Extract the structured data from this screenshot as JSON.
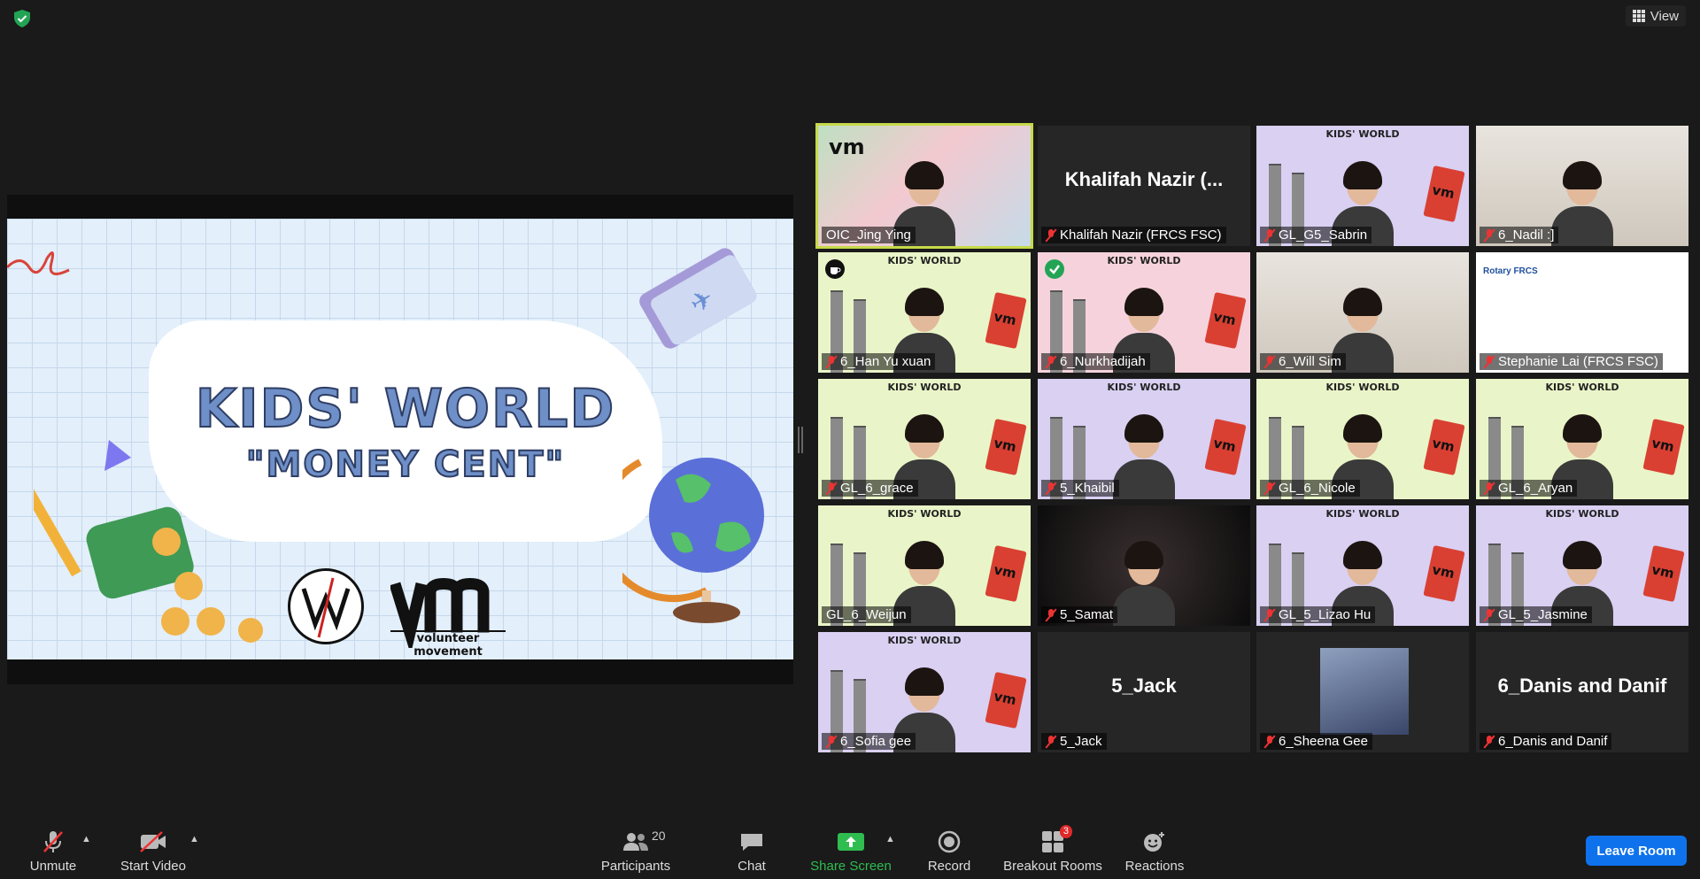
{
  "top": {
    "view_label": "View",
    "shield_icon": "shield-check-icon"
  },
  "slide": {
    "title": "KIDS' WORLD",
    "subtitle": "\"MONEY CENT\"",
    "vm_tagline": "volunteer movement"
  },
  "tiles": [
    {
      "name": "OIC_Jing Ying",
      "muted": false,
      "active": true,
      "style": "vm-pink"
    },
    {
      "name": "Khalifah Nazir (FRCS FSC)",
      "big": "Khalifah Nazir (...",
      "muted": true,
      "style": "dark"
    },
    {
      "name": "GL_G5_Sabrin",
      "muted": true,
      "style": "kw-purple"
    },
    {
      "name": "6_Nadil :]",
      "muted": true,
      "style": "room"
    },
    {
      "name": "6_Han Yu xuan",
      "muted": true,
      "style": "kw-green",
      "status_icon": "coffee-icon"
    },
    {
      "name": "6_Nurkhadijah",
      "muted": true,
      "style": "kw-pink",
      "status_icon": "check-icon"
    },
    {
      "name": "6_Will Sim",
      "muted": true,
      "style": "room"
    },
    {
      "name": "Stephanie Lai (FRCS FSC)",
      "muted": true,
      "style": "white"
    },
    {
      "name": "GL_6_grace",
      "muted": true,
      "style": "kw-green"
    },
    {
      "name": "5_Khaibil",
      "muted": true,
      "style": "kw-purple"
    },
    {
      "name": "GL_6_Nicole",
      "muted": true,
      "style": "kw-green"
    },
    {
      "name": "GL_6_Aryan",
      "muted": true,
      "style": "kw-green"
    },
    {
      "name": "GL_6_Weijun",
      "muted": false,
      "style": "kw-green"
    },
    {
      "name": "5_Samat",
      "muted": true,
      "style": "blur"
    },
    {
      "name": "GL_5_Lizao Hu",
      "muted": true,
      "style": "kw-purple"
    },
    {
      "name": "GL_5_Jasmine",
      "muted": true,
      "style": "kw-purple"
    },
    {
      "name": "6_Sofia gee",
      "muted": true,
      "style": "kw-purple"
    },
    {
      "name": "5_Jack",
      "big": "5_Jack",
      "muted": true,
      "style": "dark"
    },
    {
      "name": "6_Sheena Gee",
      "muted": true,
      "style": "avatar"
    },
    {
      "name": "6_Danis and Danif",
      "big": "6_Danis and Danif",
      "muted": true,
      "style": "dark"
    }
  ],
  "toolbar": {
    "unmute": "Unmute",
    "start_video": "Start Video",
    "participants": "Participants",
    "participant_count": "20",
    "chat": "Chat",
    "share_screen": "Share Screen",
    "record": "Record",
    "breakout_rooms": "Breakout Rooms",
    "breakout_badge": "3",
    "reactions": "Reactions",
    "leave_room": "Leave Room"
  },
  "colors": {
    "leave": "#0e72ed",
    "share": "#2fbd4f",
    "active_border": "#c6d94a",
    "muted": "#e33333"
  }
}
